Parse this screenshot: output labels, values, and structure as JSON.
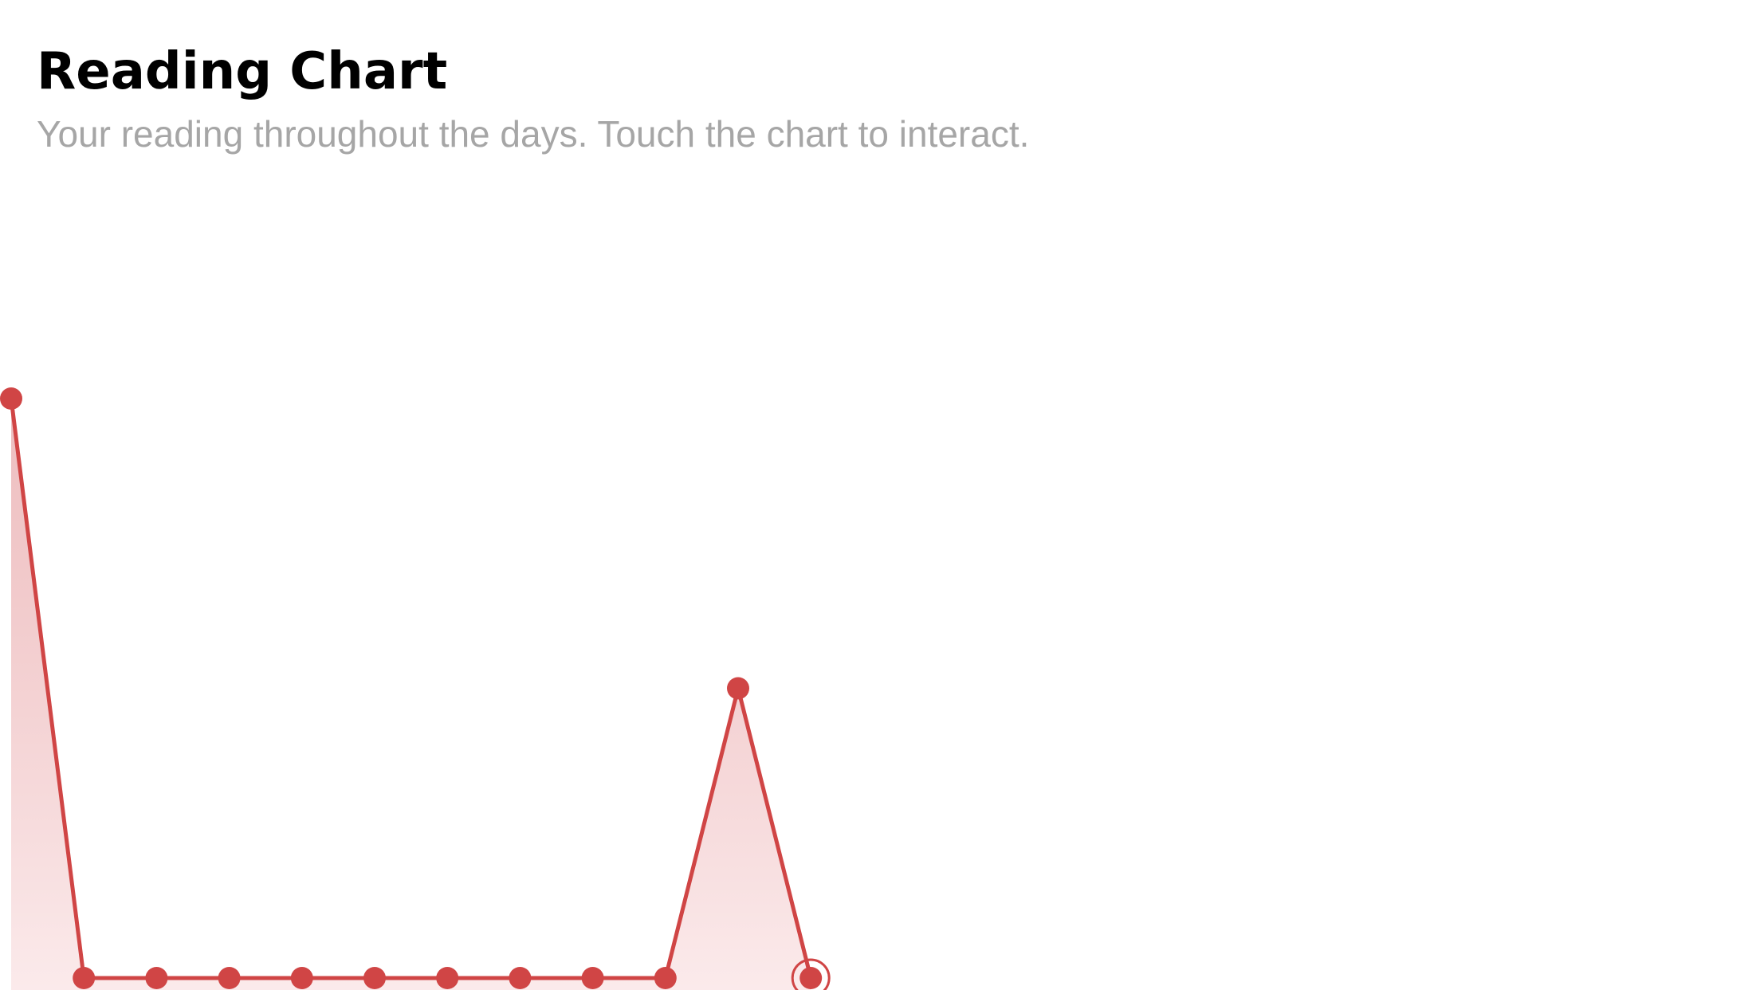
{
  "header": {
    "title": "Reading Chart",
    "subtitle": "Your reading throughout the days. Touch the chart to interact."
  },
  "colors": {
    "line": "#d04545",
    "fill_top": "#e8a8aa",
    "fill_bottom": "#fbe9ea",
    "background": "#ffffff"
  },
  "chart_data": {
    "type": "area",
    "x": [
      1,
      2,
      3,
      4,
      5,
      6,
      7,
      8,
      9,
      10,
      11,
      12
    ],
    "series": [
      {
        "values": [
          4,
          0,
          0,
          0,
          0,
          0,
          0,
          0,
          0,
          0,
          2,
          0
        ]
      }
    ],
    "ylim": [
      0,
      4
    ],
    "selected_index": 11,
    "grid": false,
    "legend": "none",
    "title": "",
    "xlabel": "",
    "ylabel": ""
  }
}
